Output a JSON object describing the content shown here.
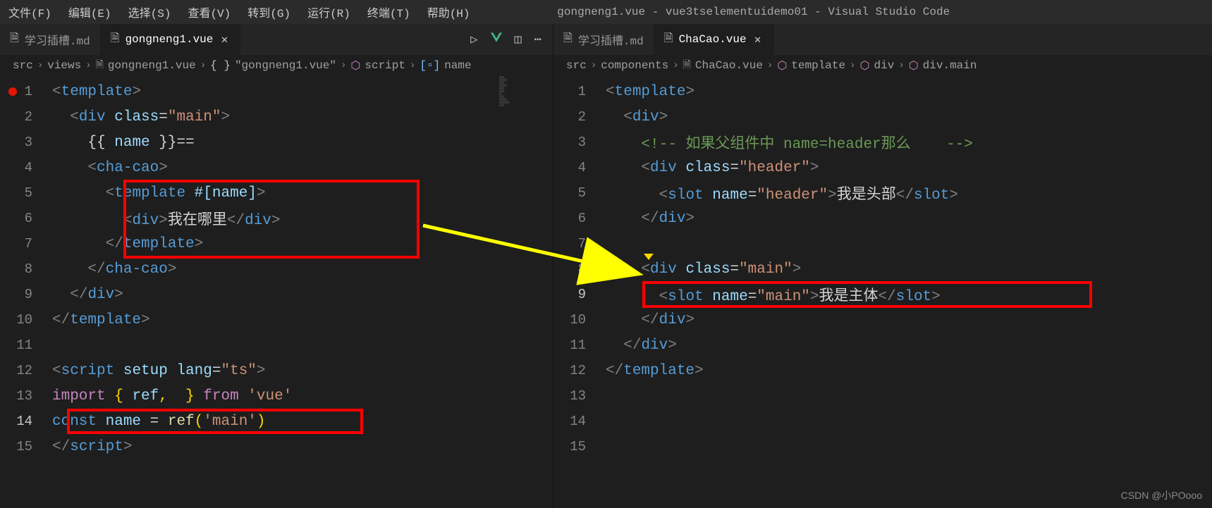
{
  "menubar": {
    "items": [
      "文件(F)",
      "编辑(E)",
      "选择(S)",
      "查看(V)",
      "转到(G)",
      "运行(R)",
      "终端(T)",
      "帮助(H)"
    ],
    "title": "gongneng1.vue - vue3tselementuidemo01 - Visual Studio Code"
  },
  "left": {
    "tabs": [
      {
        "label": "学习插槽.md",
        "active": false
      },
      {
        "label": "gongneng1.vue",
        "active": true
      }
    ],
    "breadcrumb": [
      "src",
      "views",
      "gongneng1.vue",
      "\"gongneng1.vue\"",
      "script",
      "name"
    ],
    "lines": {
      "1": "1",
      "2": "2",
      "3": "3",
      "4": "4",
      "5": "5",
      "6": "6",
      "7": "7",
      "8": "8",
      "9": "9",
      "10": "10",
      "11": "11",
      "12": "12",
      "13": "13",
      "14": "14",
      "15": "15"
    },
    "code": {
      "l1": {
        "a": "<",
        "b": "template",
        "c": ">"
      },
      "l2": {
        "a": "<",
        "b": "div",
        "sp": " ",
        "c": "class",
        "d": "=",
        "e": "\"main\"",
        "f": ">"
      },
      "l3": {
        "a": "{{ ",
        "b": "name",
        "c": " }}",
        "d": "=="
      },
      "l4": {
        "a": "<",
        "b": "cha-cao",
        "c": ">"
      },
      "l5": {
        "a": "<",
        "b": "template",
        "sp": " ",
        "c": "#[",
        "d": "name",
        "e": "]",
        "f": ">"
      },
      "l6": {
        "a": "<",
        "b": "div",
        "c": ">",
        "d": "我在哪里",
        "e": "</",
        "f": "div",
        "g": ">"
      },
      "l7": {
        "a": "</",
        "b": "template",
        "c": ">"
      },
      "l8": {
        "a": "</",
        "b": "cha-cao",
        "c": ">"
      },
      "l9": {
        "a": "</",
        "b": "div",
        "c": ">"
      },
      "l10": {
        "a": "</",
        "b": "template",
        "c": ">"
      },
      "l12": {
        "a": "<",
        "b": "script",
        "sp": " ",
        "c": "setup",
        "sp2": " ",
        "d": "lang",
        "e": "=",
        "f": "\"ts\"",
        "g": ">"
      },
      "l13": {
        "a": "import",
        "b": " { ",
        "c": "ref",
        "d": ",  } ",
        "e": "from",
        "f": " ",
        "g": "'vue'"
      },
      "l14": {
        "a": "const",
        "b": " ",
        "c": "name",
        "d": " = ",
        "e": "ref",
        "f": "(",
        "g": "'main'",
        "h": ")"
      },
      "l15": {
        "a": "</",
        "b": "script",
        "c": ">"
      }
    }
  },
  "right": {
    "tabs": [
      {
        "label": "学习插槽.md",
        "active": false
      },
      {
        "label": "ChaCao.vue",
        "active": true
      }
    ],
    "breadcrumb": [
      "src",
      "components",
      "ChaCao.vue",
      "template",
      "div",
      "div.main"
    ],
    "lines": {
      "1": "1",
      "2": "2",
      "3": "3",
      "4": "4",
      "5": "5",
      "6": "6",
      "7": "7",
      "8": "8",
      "9": "9",
      "10": "10",
      "11": "11",
      "12": "12",
      "13": "13",
      "14": "14",
      "15": "15"
    },
    "code": {
      "l1": {
        "a": "<",
        "b": "template",
        "c": ">"
      },
      "l2": {
        "a": "<",
        "b": "div",
        "c": ">"
      },
      "l3": {
        "a": "<!-- ",
        "b": "如果父组件中 name=header那么",
        "c": "    -->"
      },
      "l4": {
        "a": "<",
        "b": "div",
        "sp": " ",
        "c": "class",
        "d": "=",
        "e": "\"header\"",
        "f": ">"
      },
      "l5": {
        "a": "<",
        "b": "slot",
        "sp": " ",
        "c": "name",
        "d": "=",
        "e": "\"header\"",
        "f": ">",
        "g": "我是头部",
        "h": "</",
        "i": "slot",
        "j": ">"
      },
      "l6": {
        "a": "</",
        "b": "div",
        "c": ">"
      },
      "l8": {
        "a": "<",
        "b": "div",
        "sp": " ",
        "c": "class",
        "d": "=",
        "e": "\"main\"",
        "f": ">"
      },
      "l9": {
        "a": "<",
        "b": "slot",
        "sp": " ",
        "c": "name",
        "d": "=",
        "e": "\"main\"",
        "f": ">",
        "g": "我是主体",
        "h": "</",
        "i": "slot",
        "j": ">"
      },
      "l10": {
        "a": "</",
        "b": "div",
        "c": ">"
      },
      "l11": {
        "a": "</",
        "b": "div",
        "c": ">"
      },
      "l12": {
        "a": "</",
        "b": "template",
        "c": ">"
      }
    }
  },
  "watermark": "CSDN @小POooo"
}
